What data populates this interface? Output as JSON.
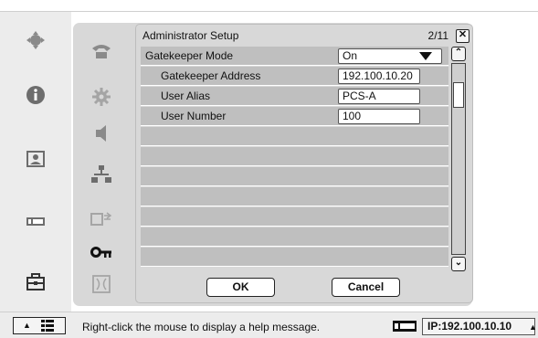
{
  "dialog": {
    "title": "Administrator Setup",
    "page_counter": "2/11",
    "close_glyph": "✕"
  },
  "rows": [
    {
      "label": "Gatekeeper Mode",
      "value": "On",
      "kind": "select"
    },
    {
      "label": "Gatekeeper Address",
      "value": "192.100.10.20",
      "kind": "input"
    },
    {
      "label": "User Alias",
      "value": "PCS-A",
      "kind": "input"
    },
    {
      "label": "User Number",
      "value": "100",
      "kind": "input"
    }
  ],
  "scroll": {
    "up_glyph": "⌃",
    "down_glyph": "⌄"
  },
  "buttons": {
    "ok": "OK",
    "cancel": "Cancel"
  },
  "status": {
    "help": "Right-click the mouse to display a help message.",
    "ip": "IP:192.100.10.10",
    "toggle_arrow": "▲",
    "ip_arrow": "▲"
  },
  "icons": {
    "left_rail": [
      "home-icon",
      "info-icon",
      "contacts-icon",
      "video-input-icon",
      "toolbox-icon"
    ],
    "inner_rail": [
      "phone-icon",
      "gear-icon",
      "speaker-icon",
      "network-icon",
      "camera-audio-icon",
      "key-icon",
      "display-icon"
    ]
  }
}
